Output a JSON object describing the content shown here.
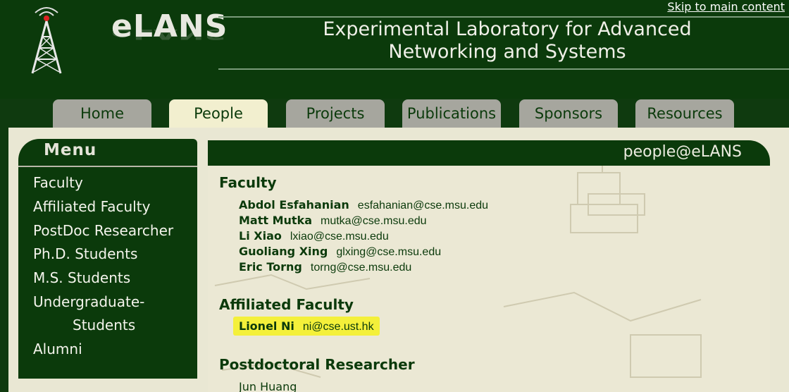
{
  "header": {
    "logo": "eLANS",
    "title_line1": "Experimental Laboratory for Advanced",
    "title_line2": "Networking and Systems",
    "skip_link": "Skip to main content"
  },
  "tabs": [
    {
      "label": "Home"
    },
    {
      "label": "People"
    },
    {
      "label": "Projects"
    },
    {
      "label": "Publications"
    },
    {
      "label": "Sponsors"
    },
    {
      "label": "Resources"
    }
  ],
  "menu": {
    "title": "Menu",
    "items": [
      {
        "label": "Faculty"
      },
      {
        "label": "Affiliated Faculty"
      },
      {
        "label": "PostDoc Researcher"
      },
      {
        "label": "Ph.D. Students"
      },
      {
        "label": "M.S. Students"
      },
      {
        "label": "Undergraduate-"
      },
      {
        "label": "Students"
      },
      {
        "label": "Alumni"
      }
    ]
  },
  "main": {
    "header_label": "people@eLANS",
    "faculty_heading": "Faculty",
    "faculty": [
      {
        "name": "Abdol Esfahanian",
        "email": "esfahanian@cse.msu.edu"
      },
      {
        "name": "Matt Mutka",
        "email": "mutka@cse.msu.edu"
      },
      {
        "name": "Li Xiao",
        "email": "lxiao@cse.msu.edu"
      },
      {
        "name": "Guoliang Xing",
        "email": "glxing@cse.msu.edu"
      },
      {
        "name": "Eric Torng",
        "email": "torng@cse.msu.edu"
      }
    ],
    "affiliated_heading": "Affiliated Faculty",
    "affiliated": [
      {
        "name": "Lionel Ni",
        "email": "ni@cse.ust.hk"
      }
    ],
    "postdoc_heading": "Postdoctoral Researcher",
    "postdoc": [
      {
        "name": "Jun Huang"
      }
    ]
  }
}
